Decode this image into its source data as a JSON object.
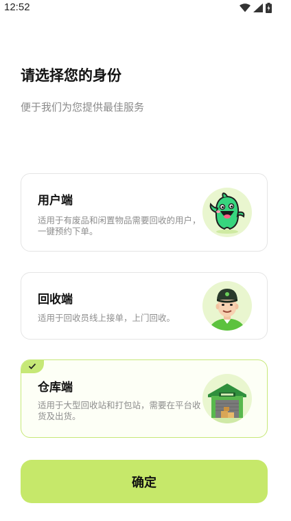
{
  "status_bar": {
    "time": "12:52"
  },
  "header": {
    "title": "请选择您的身份",
    "subtitle": "便于我们为您提供最佳服务"
  },
  "roles": [
    {
      "title": "用户端",
      "description": "适用于有废品和闲置物品需要回收的用户，一键预约下单。",
      "icon": "ghost-mascot-icon",
      "selected": false
    },
    {
      "title": "回收端",
      "description": "适用于回收员线上接单，上门回收。",
      "icon": "recycler-worker-icon",
      "selected": false
    },
    {
      "title": "仓库端",
      "description": "适用于大型回收站和打包站，需要在平台收货及出货。",
      "icon": "warehouse-icon",
      "selected": true
    }
  ],
  "confirm_label": "确定",
  "colors": {
    "accent": "#c6e86a",
    "selected_border": "#c6e877"
  }
}
